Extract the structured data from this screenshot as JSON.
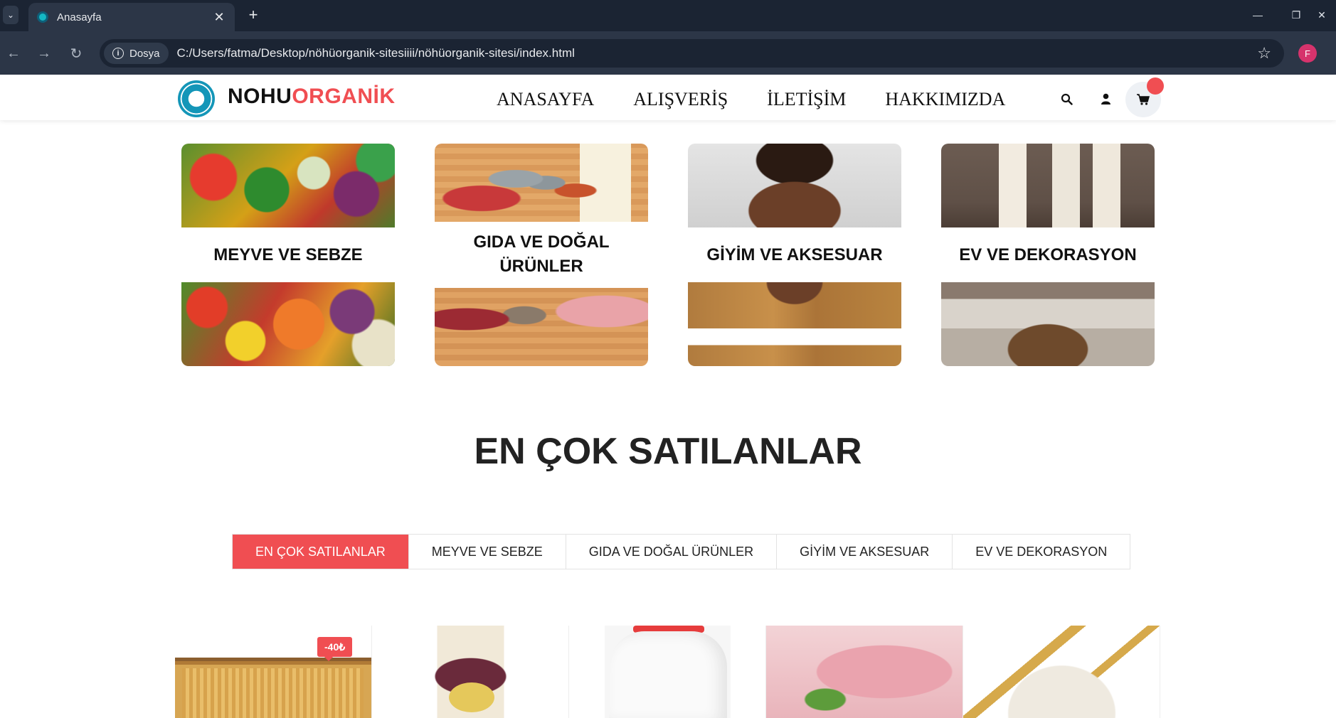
{
  "browser": {
    "tab_title": "Anasayfa",
    "site_chip": "Dosya",
    "url": "C:/Users/fatma/Desktop/nöhüorganik-sitesiiii/nöhüorganik-sitesi/index.html",
    "profile_initial": "F"
  },
  "brand": {
    "part1": "NOHU",
    "part2": "ORGANİK",
    "accent_color": "#f04e52"
  },
  "nav": [
    "ANASAYFA",
    "ALIŞVERİŞ",
    "İLETİŞİM",
    "HAKKIMIZDA"
  ],
  "header_icons": [
    "search-icon",
    "user-icon",
    "cart-icon"
  ],
  "categories": [
    {
      "line1": "MEYVE VE SEBZE",
      "line2": ""
    },
    {
      "line1": "GIDA VE DOĞAL",
      "line2": "ÜRÜNLER"
    },
    {
      "line1": "GİYİM VE AKSESUAR",
      "line2": ""
    },
    {
      "line1": "EV VE DEKORASYON",
      "line2": ""
    }
  ],
  "section_title": "EN ÇOK SATILANLAR",
  "filters": [
    "EN ÇOK SATILANLAR",
    "MEYVE VE SEBZE",
    "GIDA VE DOĞAL ÜRÜNLER",
    "GİYİM VE AKSESUAR",
    "EV VE DEKORASYON"
  ],
  "active_filter": "EN ÇOK SATILANLAR",
  "products": [
    {
      "image": "honeycomb",
      "badge": "-40₺"
    },
    {
      "image": "echinacea-tea-pack",
      "badge": ""
    },
    {
      "image": "milk-bottle",
      "badge": ""
    },
    {
      "image": "raw-chicken",
      "badge": ""
    },
    {
      "image": "wheat-flour",
      "badge": ""
    }
  ]
}
